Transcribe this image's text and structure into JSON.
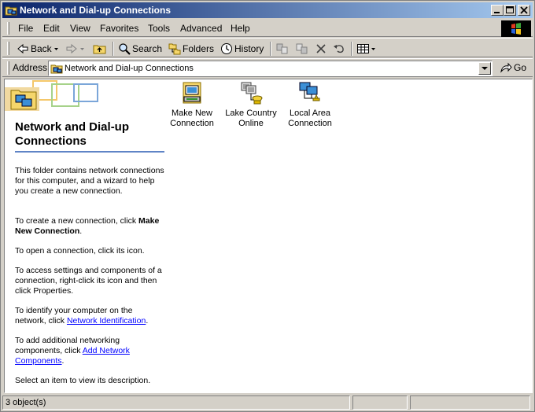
{
  "window": {
    "title": "Network and Dial-up Connections"
  },
  "menu": [
    "File",
    "Edit",
    "View",
    "Favorites",
    "Tools",
    "Advanced",
    "Help"
  ],
  "toolbar": {
    "back": "Back",
    "search": "Search",
    "folders": "Folders",
    "history": "History"
  },
  "address": {
    "label": "Address",
    "value": "Network and Dial-up Connections",
    "go": "Go"
  },
  "left_pane": {
    "title": "Network and Dial-up Connections",
    "intro": "This folder contains network connections for this computer, and a wizard to help you create a new connection.",
    "create_prefix": "To create a new connection, click",
    "create_bold": "Make New Connection",
    "create_suffix": ".",
    "open": "To open a connection, click its icon.",
    "access": "To access settings and components of a connection, right-click its icon and then click Properties.",
    "identify_prefix": "To identify your computer on the network, click",
    "identify_link": "Network Identification",
    "identify_suffix": ".",
    "add_prefix": "To add additional networking components, click",
    "add_link": "Add Network Components",
    "add_suffix": ".",
    "select": "Select an item to view its description."
  },
  "icons": [
    {
      "label": "Make New Connection",
      "icon": "make-new-connection-icon"
    },
    {
      "label": "Lake Country Online",
      "icon": "dial-up-connection-icon"
    },
    {
      "label": "Local Area Connection",
      "icon": "lan-connection-icon"
    }
  ],
  "status": {
    "count": "3 object(s)"
  },
  "colors": {
    "title_gradient_start": "#0a246a",
    "title_gradient_end": "#a6caf0",
    "accent_rule": "#5f84c6",
    "link": "#0000ff"
  }
}
